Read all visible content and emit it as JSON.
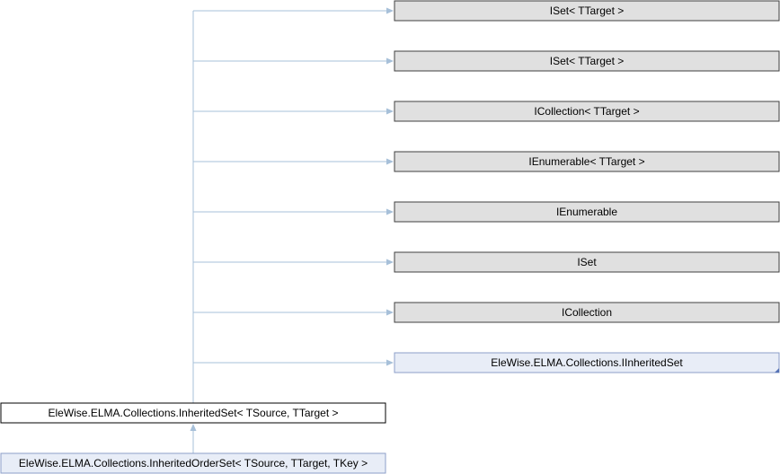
{
  "diagram": {
    "interfaces": [
      {
        "label": "ISet< TTarget >",
        "style": "plain"
      },
      {
        "label": "ISet< TTarget >",
        "style": "plain"
      },
      {
        "label": "ICollection< TTarget >",
        "style": "plain"
      },
      {
        "label": "IEnumerable< TTarget >",
        "style": "plain"
      },
      {
        "label": "IEnumerable",
        "style": "plain"
      },
      {
        "label": "ISet",
        "style": "plain"
      },
      {
        "label": "ICollection",
        "style": "plain"
      },
      {
        "label": "EleWise.ELMA.Collections.IInheritedSet",
        "style": "link"
      }
    ],
    "current_class": {
      "label": "EleWise.ELMA.Collections.InheritedSet< TSource, TTarget >"
    },
    "derived_class": {
      "label": "EleWise.ELMA.Collections.InheritedOrderSet< TSource, TTarget, TKey >"
    },
    "colors": {
      "edge": "#a7c0d9",
      "plain_fill": "#e0e0e0",
      "link_fill": "#e8edf7",
      "link_border": "#8c9fc9"
    }
  }
}
